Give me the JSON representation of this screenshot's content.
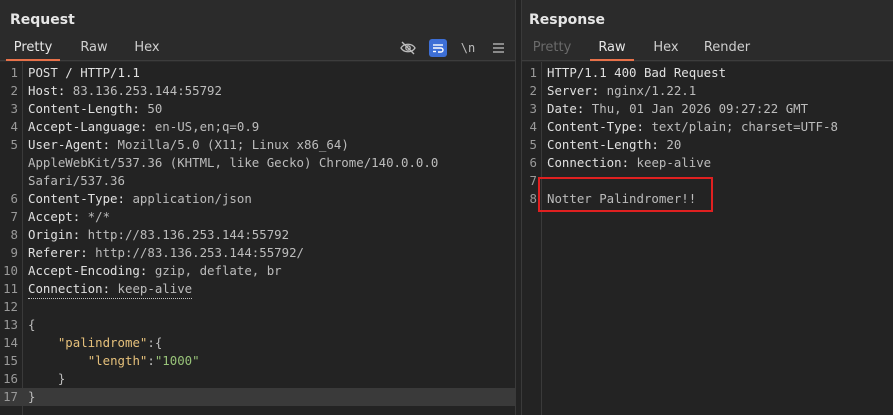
{
  "request": {
    "title": "Request",
    "tabs": [
      "Pretty",
      "Raw",
      "Hex"
    ],
    "active_tab": "Pretty",
    "tools": {
      "hide_icon": "eye-slash-icon",
      "wrap_icon": "word-wrap-icon",
      "newline_label": "\\n",
      "menu_icon": "hamburger-menu-icon"
    },
    "lines": [
      {
        "n": "1",
        "name": "POST / HTTP/1.1",
        "value": ""
      },
      {
        "n": "2",
        "name": "Host:",
        "value": " 83.136.253.144:55792"
      },
      {
        "n": "3",
        "name": "Content-Length:",
        "value": " 50"
      },
      {
        "n": "4",
        "name": "Accept-Language:",
        "value": " en-US,en;q=0.9"
      },
      {
        "n": "5",
        "name": "User-Agent:",
        "value": " Mozilla/5.0 (X11; Linux x86_64)"
      },
      {
        "n": "",
        "name": "",
        "value": "AppleWebKit/537.36 (KHTML, like Gecko) Chrome/140.0.0.0"
      },
      {
        "n": "",
        "name": "",
        "value": "Safari/537.36"
      },
      {
        "n": "6",
        "name": "Content-Type:",
        "value": " application/json"
      },
      {
        "n": "7",
        "name": "Accept:",
        "value": " */*"
      },
      {
        "n": "8",
        "name": "Origin:",
        "value": " http://83.136.253.144:55792"
      },
      {
        "n": "9",
        "name": "Referer:",
        "value": " http://83.136.253.144:55792/"
      },
      {
        "n": "10",
        "name": "Accept-Encoding:",
        "value": " gzip, deflate, br"
      },
      {
        "n": "11",
        "name": "Connection:",
        "value": " keep-alive"
      },
      {
        "n": "12",
        "name": "",
        "value": ""
      },
      {
        "n": "13",
        "name": "",
        "value": "{"
      },
      {
        "n": "14",
        "name": "",
        "value": "    \"palindrome\":{"
      },
      {
        "n": "15",
        "name": "",
        "value": "        \"length\":\"1000\""
      },
      {
        "n": "16",
        "name": "",
        "value": "    }"
      },
      {
        "n": "17",
        "name": "",
        "value": "}"
      }
    ]
  },
  "response": {
    "title": "Response",
    "tabs": [
      "Pretty",
      "Raw",
      "Hex",
      "Render"
    ],
    "active_tab": "Raw",
    "lines": [
      {
        "n": "1",
        "name": "HTTP/1.1 400 Bad Request",
        "value": ""
      },
      {
        "n": "2",
        "name": "Server:",
        "value": " nginx/1.22.1"
      },
      {
        "n": "3",
        "name": "Date:",
        "value": " Thu, 01 Jan 2026 09:27:22 GMT"
      },
      {
        "n": "4",
        "name": "Content-Type:",
        "value": " text/plain; charset=UTF-8"
      },
      {
        "n": "5",
        "name": "Content-Length:",
        "value": " 20"
      },
      {
        "n": "6",
        "name": "Connection:",
        "value": " keep-alive"
      },
      {
        "n": "7",
        "name": "",
        "value": ""
      },
      {
        "n": "8",
        "name": "",
        "value": "Notter Palindromer!!"
      }
    ]
  },
  "colors": {
    "accent": "#e8724a",
    "highlight_box": "#e02020",
    "json_key": "#e5c07b",
    "json_string": "#98c379"
  }
}
